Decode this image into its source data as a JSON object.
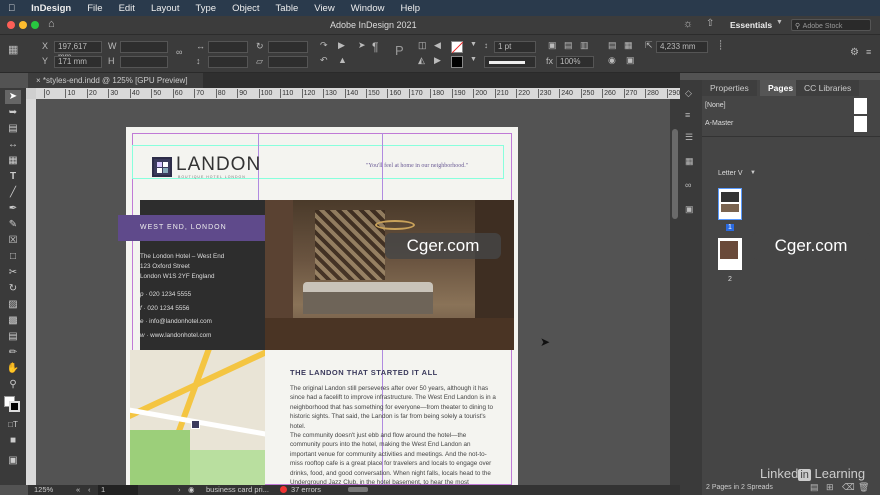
{
  "menubar": {
    "app": "InDesign",
    "items": [
      "File",
      "Edit",
      "Layout",
      "Type",
      "Object",
      "Table",
      "View",
      "Window",
      "Help"
    ]
  },
  "titlebar": {
    "title": "Adobe InDesign 2021",
    "workspace": "Essentials",
    "stock_placeholder": "Adobe Stock"
  },
  "control": {
    "x": "197,617 mm",
    "y": "171 mm",
    "stroke_weight": "1 pt",
    "opacity": "100%",
    "measure": "4,233 mm"
  },
  "doc_tab": {
    "label": "*styles-end.indd @ 125% [GPU Preview]"
  },
  "ruler": {
    "ticks": [
      "0",
      "10",
      "20",
      "30",
      "40",
      "50",
      "60",
      "70",
      "80",
      "90",
      "100",
      "110",
      "120",
      "130",
      "140",
      "150",
      "160",
      "170",
      "180",
      "190",
      "200",
      "210",
      "220",
      "230",
      "240",
      "250",
      "260",
      "270",
      "280",
      "290"
    ]
  },
  "layout": {
    "logo": "LANDON",
    "logo_sub": "BOUTIQUE HOTEL LONDON",
    "tagline": "\"You'll feel at home in our neighborhood.\"",
    "banner": "WEST END, LONDON",
    "address": [
      "The London Hotel – West End",
      "123 Oxford Street",
      "London W1S 2YF England"
    ],
    "contacts": [
      {
        "k": "p",
        "v": "020 1234 5555"
      },
      {
        "k": "f",
        "v": "020 1234 5556"
      },
      {
        "k": "e",
        "v": "info@landonhotel.com"
      },
      {
        "k": "w",
        "v": "www.landonhotel.com"
      }
    ],
    "heading": "THE LANDON THAT STARTED IT ALL",
    "body": [
      "The original Landon still perseveres after over 50 years, although it has since had a facelift to improve infrastructure. The West End Landon is in a neighborhood that has something for everyone—from theater to dining to historic sights. That said, the Landon is far from being solely a tourist's hotel.",
      "The community doesn't just ebb and flow around the hotel—the community pours into the hotel, making the West End Landon an important venue for community activities and meetings. And the not-to-miss rooftop cafe is a great place for travelers and locals to engage over drinks, food, and good conversation. When night falls, locals head to the Underground Jazz Club, in the hotel basement, to hear the most"
    ]
  },
  "status": {
    "zoom": "125%",
    "page": "1",
    "style": "business card pri...",
    "errors": "37 errors"
  },
  "panel": {
    "tabs": [
      "Properties",
      "Pages",
      "CC Libraries"
    ],
    "masters": [
      "[None]",
      "A-Master"
    ],
    "size": "Letter V",
    "pages": [
      "1",
      "2"
    ],
    "footer": "2 Pages in 2 Spreads"
  },
  "watermarks": [
    "Cger.com",
    "Cger.com"
  ],
  "brand": {
    "linkedin": "Linked",
    "learning": "Learning"
  }
}
